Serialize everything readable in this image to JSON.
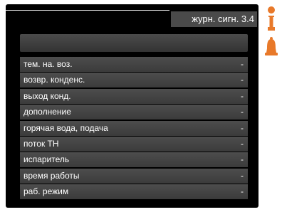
{
  "header": {
    "title": "журн. сигн. 3.4"
  },
  "items": [
    {
      "label": "тем. на. воз.",
      "value": "-"
    },
    {
      "label": "возвр. конденс.",
      "value": "-"
    },
    {
      "label": "выход конд.",
      "value": "-"
    },
    {
      "label": "дополнение",
      "value": "-"
    },
    {
      "label": "горячая вода, подача",
      "value": "-"
    },
    {
      "label": "поток ТН",
      "value": "-"
    },
    {
      "label": "испаритель",
      "value": "-"
    },
    {
      "label": "время работы",
      "value": "-"
    },
    {
      "label": "раб. режим",
      "value": "-"
    }
  ],
  "side_icons": [
    "info-icon",
    "alarm-bell-icon"
  ],
  "colors": {
    "screen_bg": "#000000",
    "row_bg": "#444444",
    "accent_orange": "#e8792a"
  }
}
